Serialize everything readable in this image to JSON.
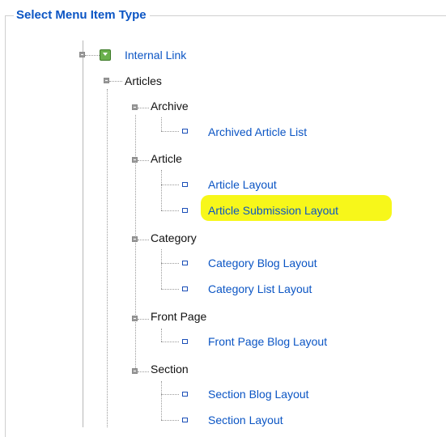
{
  "legend": "Select Menu Item Type",
  "tree": {
    "root": "Internal Link",
    "articles": "Articles",
    "archive": "Archive",
    "archived_article_list": "Archived Article List",
    "article": "Article",
    "article_layout": "Article Layout",
    "article_submission_layout": "Article Submission Layout",
    "category": "Category",
    "category_blog_layout": "Category Blog Layout",
    "category_list_layout": "Category List Layout",
    "front_page": "Front Page",
    "front_page_blog_layout": "Front Page Blog Layout",
    "section": "Section",
    "section_blog_layout": "Section Blog Layout",
    "section_layout": "Section Layout"
  },
  "colors": {
    "link": "#0b55c4",
    "highlight": "#f7f71a",
    "icon_green": "#6ab04c"
  },
  "highlighted_item": "Article Submission Layout"
}
